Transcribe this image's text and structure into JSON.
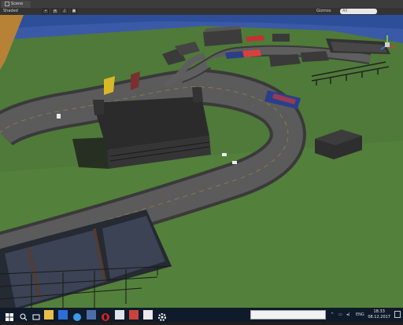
{
  "editor": {
    "tab_label": "Scene",
    "shading_mode": "Shaded",
    "gizmos_label": "Gizmos",
    "search_placeholder": "All"
  },
  "toolbar_icons": [
    "2d-toggle-icon",
    "lighting-icon",
    "audio-icon",
    "effects-icon"
  ],
  "taskbar": {
    "language": "ENG",
    "time": "18:33",
    "date": "08.12.2017",
    "pinned_apps": [
      "start-icon",
      "search-icon",
      "task-view-icon",
      "file-explorer-icon",
      "store-icon",
      "edge-icon",
      "app-icon",
      "opera-icon",
      "app-icon",
      "app-icon",
      "unity-icon",
      "settings-icon"
    ]
  },
  "colors": {
    "sky": "#2d4f9a",
    "grass": "#4f7a39",
    "road": "#545454",
    "taskbar": "#0f1b2a",
    "gizmo_x": "#d83a3a",
    "gizmo_y": "#7fc13a",
    "gizmo_z": "#3a6fd8"
  }
}
